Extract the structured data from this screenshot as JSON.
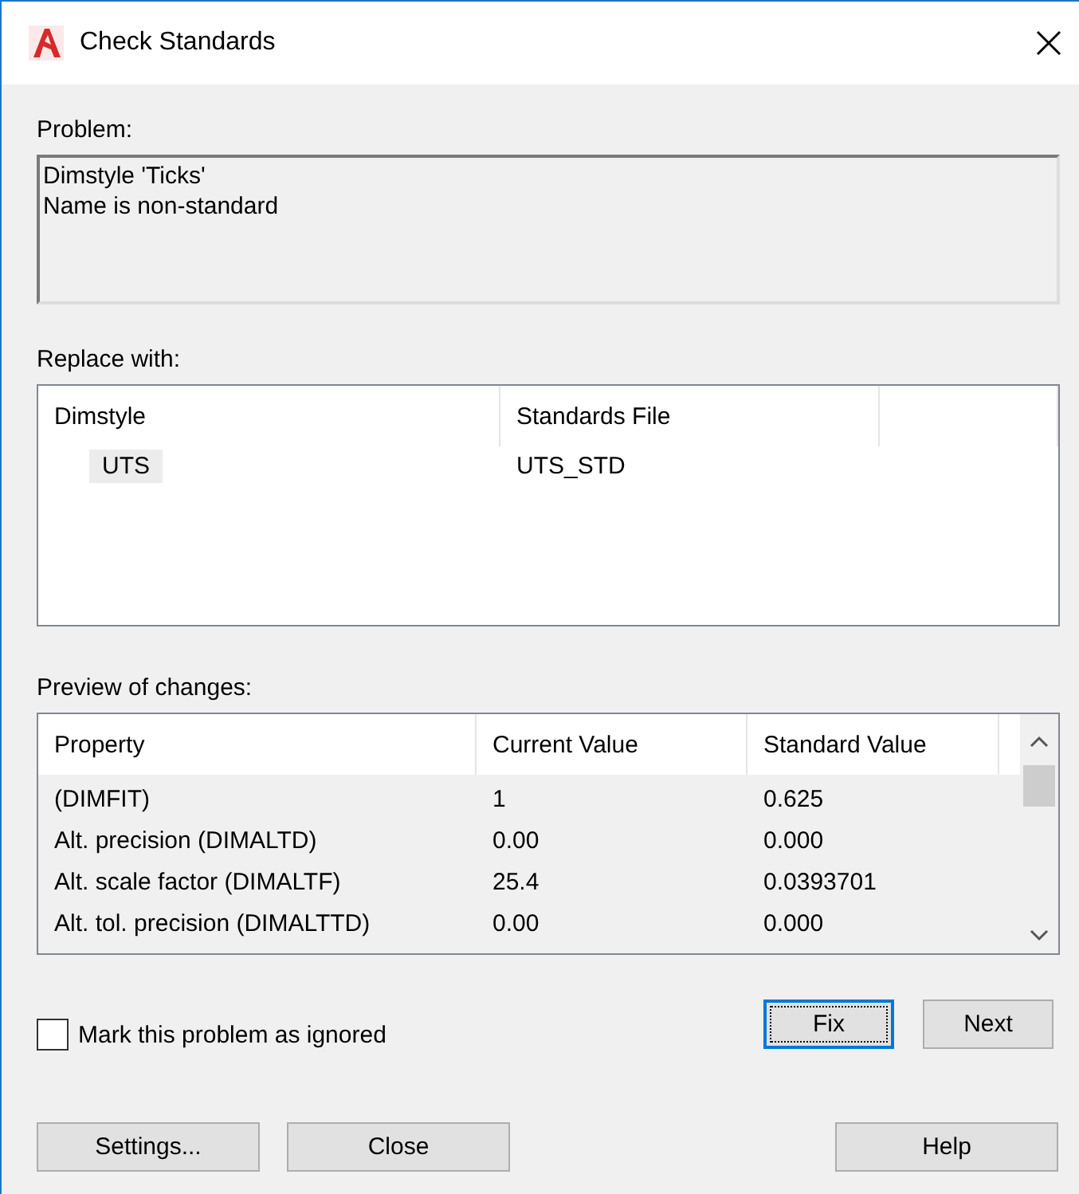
{
  "window": {
    "title": "Check Standards"
  },
  "problem": {
    "label": "Problem:",
    "lines": [
      "Dimstyle 'Ticks'",
      "Name is non-standard"
    ]
  },
  "replace_with": {
    "label": "Replace with:",
    "columns": [
      "Dimstyle",
      "Standards File"
    ],
    "rows": [
      {
        "cells": [
          "UTS",
          "UTS_STD"
        ],
        "selected": true
      }
    ]
  },
  "preview": {
    "label": "Preview of changes:",
    "columns": [
      "Property",
      "Current Value",
      "Standard Value"
    ],
    "rows": [
      [
        "(DIMFIT)",
        "1",
        "0.625"
      ],
      [
        "Alt. precision (DIMALTD)",
        "0.00",
        "0.000"
      ],
      [
        "Alt. scale factor (DIMALTF)",
        "25.4",
        "0.0393701"
      ],
      [
        "Alt. tol. precision (DIMALTTD)",
        "0.00",
        "0.000"
      ]
    ]
  },
  "ignore": {
    "label": "Mark this problem as ignored",
    "checked": false
  },
  "action_buttons": [
    {
      "label": "Fix",
      "focused": true
    },
    {
      "label": "Next",
      "focused": false
    }
  ],
  "footer_buttons": [
    "Settings...",
    "Close",
    "Help"
  ]
}
